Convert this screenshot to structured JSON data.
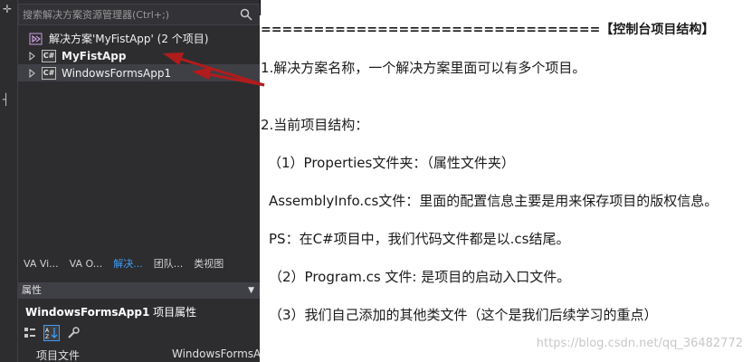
{
  "solution_explorer": {
    "search_placeholder": "搜索解决方案资源管理器(Ctrl+;)",
    "tree": {
      "solution_label": "解决方案'MyFistApp' (2 个项目)",
      "project1": {
        "label": "MyFistApp",
        "icon_text": "C#"
      },
      "project2": {
        "label": "WindowsFormsApp1",
        "icon_text": "C#"
      }
    },
    "tabs": [
      {
        "label": "VA Vi..."
      },
      {
        "label": "VA O..."
      },
      {
        "label": "解决..."
      },
      {
        "label": "团队..."
      },
      {
        "label": "类视图"
      }
    ]
  },
  "properties": {
    "title": "属性",
    "object_name": "WindowsFormsApp1",
    "object_type": "项目属性",
    "row_name": "项目文件",
    "row_value": "WindowsFormsApp"
  },
  "notes": {
    "header": "================================【控制台项目结构】",
    "line1": "1.解决方案名称，一个解决方案里面可以有多个项目。",
    "line2": "2.当前项目结构：",
    "line3": "（1）Properties文件夹：（属性文件夹）",
    "line4": "AssemblyInfo.cs文件：里面的配置信息主要是用来保存项目的版权信息。",
    "line5": "PS：在C#项目中，我们代码文件都是以.cs结尾。",
    "line6": "（2）Program.cs 文件: 是项目的启动入口文件。",
    "line7": "（3）我们自己添加的其他类文件（这个是我们后续学习的重点）"
  },
  "watermark": "https://blog.csdn.net/qq_36482772",
  "colors": {
    "panel_bg": "#2d2d30",
    "active_tab": "#3e9cf7",
    "arrow": "#b01c1c"
  }
}
